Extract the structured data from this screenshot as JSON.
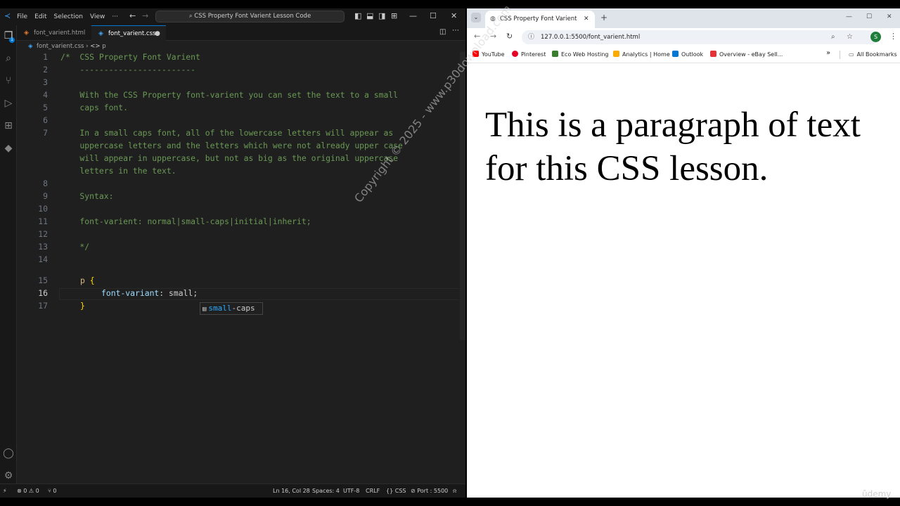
{
  "vscode": {
    "menu": [
      "File",
      "Edit",
      "Selection",
      "View",
      "···"
    ],
    "command_center": "CSS Property Font Varient Lesson Code",
    "tabs": [
      {
        "label": "font_varient.html",
        "active": false
      },
      {
        "label": "font_varient.css",
        "active": true,
        "dirty": true
      }
    ],
    "breadcrumb": {
      "file": "font_varient.css",
      "symbol": "p"
    },
    "editor": {
      "lines": [
        {
          "n": "1",
          "text": "/*  CSS Property Font Varient"
        },
        {
          "n": "2",
          "text": "    ------------------------"
        },
        {
          "n": "3",
          "text": ""
        },
        {
          "n": "4",
          "text": "    With the CSS Property font-varient you can set the text to a small"
        },
        {
          "n": "5",
          "text": "    caps font."
        },
        {
          "n": "6",
          "text": ""
        },
        {
          "n": "7",
          "text": "    In a small caps font, all of the lowercase letters will appear as"
        },
        {
          "n": "",
          "text": "    uppercase letters and the letters which were not already upper case"
        },
        {
          "n": "",
          "text": "    will appear in uppercase, but not as big as the original uppercase"
        },
        {
          "n": "",
          "text": "    letters in the text."
        },
        {
          "n": "8",
          "text": ""
        },
        {
          "n": "9",
          "text": "    Syntax:"
        },
        {
          "n": "10",
          "text": ""
        },
        {
          "n": "11",
          "text": "    font-varient: normal|small-caps|initial|inherit;"
        },
        {
          "n": "12",
          "text": ""
        },
        {
          "n": "13",
          "text": "    */"
        },
        {
          "n": "14",
          "text": ""
        }
      ],
      "line15": {
        "n": "15",
        "selector": "p",
        "brace": "{"
      },
      "line16": {
        "n": "16",
        "prop": "font-variant",
        "colon": ": ",
        "value": "small",
        "semi": ";"
      },
      "line17": {
        "n": "17",
        "brace": "}"
      },
      "suggestion": {
        "match": "small",
        "rest": "-caps"
      }
    },
    "status": {
      "errors": "0",
      "warnings": "0",
      "ports": "0",
      "position": "Ln 16, Col 28",
      "spaces": "Spaces: 4",
      "encoding": "UTF-8",
      "eol": "CRLF",
      "language": "CSS",
      "port": "Port : 5500"
    }
  },
  "browser": {
    "tab_title": "CSS Property Font Varient",
    "url": "127.0.0.1:5500/font_varient.html",
    "profile": "S",
    "bookmarks": [
      {
        "label": "YouTube",
        "color": "#ff0000"
      },
      {
        "label": "Pinterest",
        "color": "#e60023"
      },
      {
        "label": "Eco Web Hosting",
        "color": "#3a7d2c"
      },
      {
        "label": "Analytics | Home",
        "color": "#f9ab00"
      },
      {
        "label": "Outlook",
        "color": "#0078d4"
      },
      {
        "label": "Overview - eBay Sell...",
        "color": "#e53238"
      }
    ],
    "all_bookmarks": "All Bookmarks",
    "paragraph": "This is a paragraph of text for this CSS lesson."
  },
  "overlay": {
    "watermark": "Copyright © 2025 - www.p30download.com",
    "udemy": "ûdemy"
  }
}
